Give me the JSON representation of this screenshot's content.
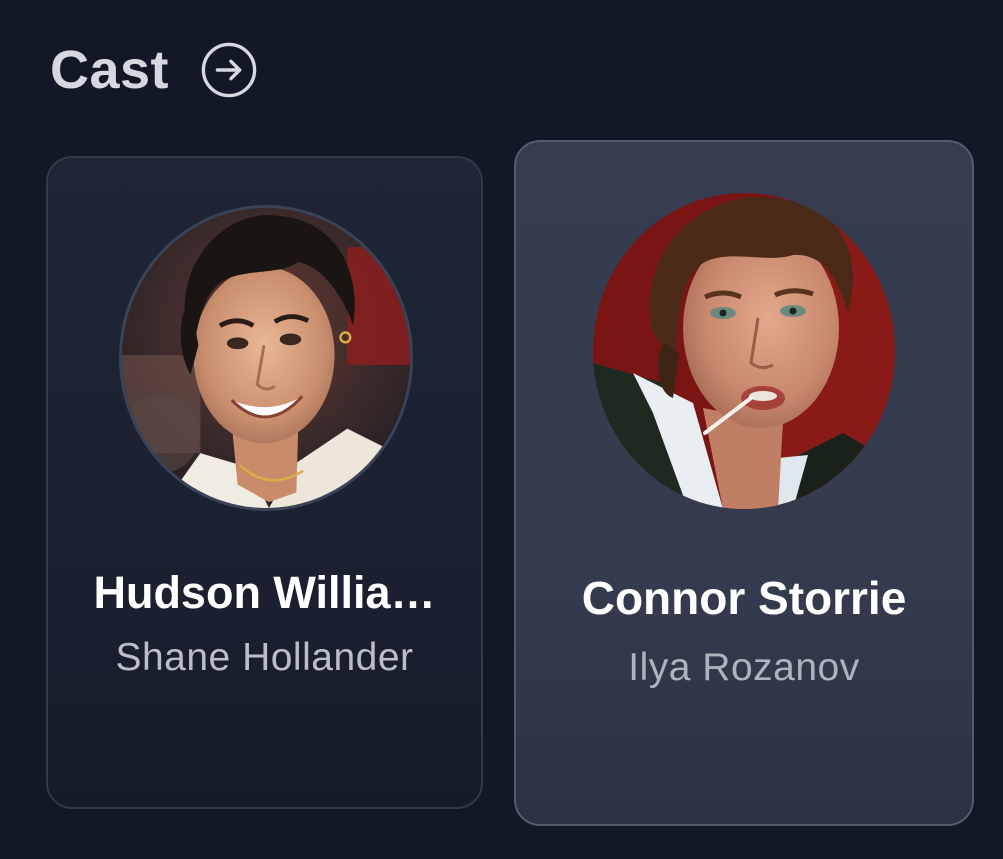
{
  "section": {
    "title": "Cast",
    "arrow_icon": "arrow-right-circle-icon"
  },
  "cast": [
    {
      "actor": "Hudson Willia…",
      "character": "Shane Hollander",
      "avatar_icon": "actor-photo"
    },
    {
      "actor": "Connor Storrie",
      "character": "Ilya Rozanov",
      "avatar_icon": "actor-photo"
    }
  ],
  "colors": {
    "background": "#121826",
    "card": "#1e2535",
    "card_highlight": "#363d50",
    "title_text": "#d4d8df",
    "secondary_text": "#b9bec8"
  }
}
